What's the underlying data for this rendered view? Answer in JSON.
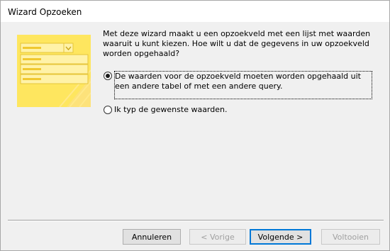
{
  "window": {
    "title": "Wizard Opzoeken"
  },
  "instructions": "Met deze wizard maakt u een opzoekveld met een lijst met waarden waaruit u kunt kiezen. Hoe wilt u dat de gegevens in uw opzoekveld worden opgehaald?",
  "options": [
    {
      "label": "De waarden voor de opzoekveld moeten worden opgehaald uit een andere tabel of met een andere query.",
      "selected": true
    },
    {
      "label": "Ik typ de gewenste waarden.",
      "selected": false
    }
  ],
  "buttons": {
    "cancel": "Annuleren",
    "back": "< Vorige",
    "next": "Volgende >",
    "finish": "Voltooien"
  },
  "colors": {
    "illustration_yellow": "#fee65f",
    "illustration_light": "#fff2a8",
    "default_button_border": "#0078d7"
  },
  "icons": {
    "illustration": "lookup-wizard-illustration",
    "dropdown": "chevron-down-icon"
  }
}
